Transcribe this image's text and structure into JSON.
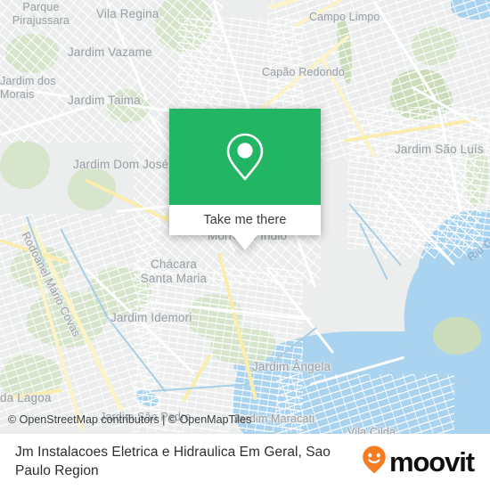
{
  "map": {
    "attribution": "© OpenStreetMap contributors | © OpenMapTiles",
    "labels": [
      {
        "id": "parque-pirajussara",
        "text": "Parque\nPirajussara"
      },
      {
        "id": "vila-regina",
        "text": "Vila Regina"
      },
      {
        "id": "campo-limpo",
        "text": "Campo Limpo"
      },
      {
        "id": "jardim-vazame",
        "text": "Jardim Vazame"
      },
      {
        "id": "capao-redondo",
        "text": "Capão Redondo"
      },
      {
        "id": "jardim-dos-morais",
        "text": "Jardim dos\nMorais"
      },
      {
        "id": "jardim-taima",
        "text": "Jardim Taima"
      },
      {
        "id": "jardim-dom-jose",
        "text": "Jardim Dom José"
      },
      {
        "id": "jardim-sao-luis",
        "text": "Jardim São Luís"
      },
      {
        "id": "morro-do-indio",
        "text": "Morro do Índio"
      },
      {
        "id": "chacara-santa-maria",
        "text": "Chácara\nSanta Maria"
      },
      {
        "id": "jardim-idemori",
        "text": "Jardim Idemori"
      },
      {
        "id": "rodoanel-mario-covas",
        "text": "Rodoanel Mário Covas"
      },
      {
        "id": "da-lagoa",
        "text": "da Lagoa"
      },
      {
        "id": "jardim-angela",
        "text": "Jardim Ângela"
      },
      {
        "id": "jardim-sao-pedro",
        "text": "Jardim São Pedro"
      },
      {
        "id": "jardim-maracati",
        "text": "Jardim Maracati"
      },
      {
        "id": "vila-cilda",
        "text": "Vila Cilda"
      },
      {
        "id": "rio-guarapiranga",
        "text": "Rio G"
      }
    ]
  },
  "popup": {
    "icon": "map-pin-icon",
    "action_label": "Take me there",
    "accent_color": "#22b564"
  },
  "footer": {
    "title": "Jm Instalacoes Eletrica e Hidraulica Em Geral, Sao Paulo Region",
    "brand_name": "moovit",
    "brand_icon": "moovit-smiling-pin-icon",
    "brand_color": "#f57c20"
  }
}
